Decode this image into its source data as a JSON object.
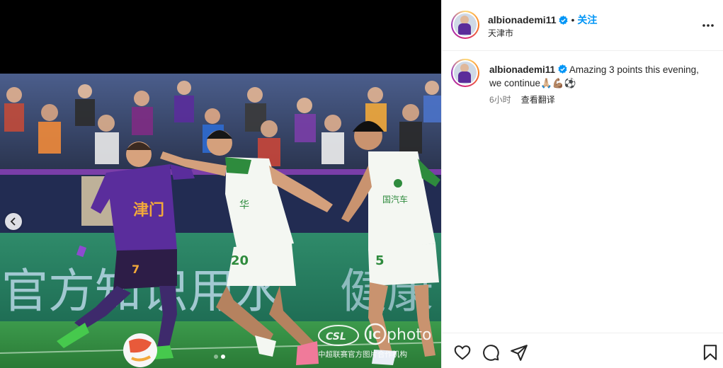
{
  "post": {
    "username": "albionademi11",
    "follow_label": "关注",
    "separator": "•",
    "location": "天津市",
    "caption_user": "albionademi11",
    "caption_text": "Amazing 3 points this evening, we continue🙏🏼💪🏽⚽",
    "time_ago": "6小时",
    "translate_label": "查看翻译"
  },
  "media": {
    "watermark_csl": "CSL",
    "watermark_ic": "IC",
    "watermark_photo": "photo",
    "watermark_caption": "中超联赛官方图片合作机构",
    "board_text": "官方知识用水",
    "board_text_right": "健康",
    "jersey_home_text": "津门",
    "jersey_home_number": "7",
    "jersey_away_number_1": "20",
    "jersey_away_number_2": "5",
    "slide_count": 2,
    "active_slide": 2
  },
  "icons": {
    "like": "heart-icon",
    "comment": "comment-icon",
    "share": "share-icon",
    "save": "bookmark-icon",
    "more": "more-icon",
    "verified": "verified-badge-icon",
    "prev": "chevron-left-icon"
  },
  "colors": {
    "follow": "#0095f6",
    "verified": "#0095f6",
    "home_kit": "#5a2d9c",
    "away_kit": "#f4f7f2",
    "away_trim": "#2e8b3d",
    "pitch": "#2f8a3e"
  }
}
